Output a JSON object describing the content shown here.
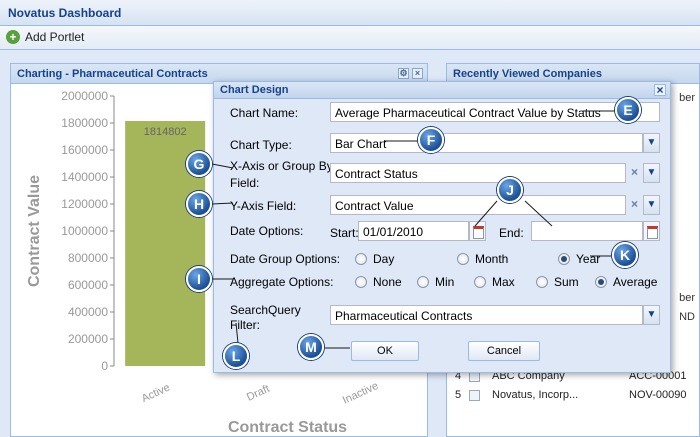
{
  "app": {
    "title": "Novatus Dashboard",
    "add_portlet_label": "Add Portlet"
  },
  "chart_portlet": {
    "title": "Charting - Pharmaceutical Contracts"
  },
  "recent_portlet": {
    "title": "Recently Viewed Companies",
    "col_fragment": "ber",
    "rows": [
      {
        "num": "4",
        "name": "ABC Company",
        "code": "ACC-00001"
      },
      {
        "num": "5",
        "name": "Novatus, Incorp...",
        "code": "NOV-00090"
      }
    ],
    "side_fragments": [
      "ber",
      "ND"
    ]
  },
  "chart_data": {
    "type": "bar",
    "ylabel": "Contract Value",
    "xlabel": "Contract Status",
    "categories": [
      "Active",
      "Draft",
      "Inactive"
    ],
    "values": [
      1814802,
      null,
      null
    ],
    "data_labels": [
      "1814802"
    ],
    "ylim": [
      0,
      2000000
    ],
    "yticks": [
      "0",
      "200000",
      "400000",
      "600000",
      "800000",
      "1000000",
      "1200000",
      "1400000",
      "1600000",
      "1800000",
      "2000000"
    ],
    "bar_color": "#a5b55a"
  },
  "dialog": {
    "title": "Chart Design",
    "chart_name_label": "Chart Name:",
    "chart_name_value": "Average Pharmaceutical Contract Value by Status",
    "chart_type_label": "Chart Type:",
    "chart_type_value": "Bar Chart",
    "xaxis_label_line1": "X-Axis or Group By",
    "xaxis_label_line2": "Field:",
    "xaxis_value": "Contract Status",
    "yaxis_label": "Y-Axis Field:",
    "yaxis_value": "Contract Value",
    "date_options_label": "Date Options:",
    "start_label": "Start:",
    "start_value": "01/01/2010",
    "end_label": "End:",
    "end_value": "",
    "date_group_label": "Date Group Options:",
    "date_group_options": [
      "Day",
      "Month",
      "Year"
    ],
    "date_group_selected": "Year",
    "aggregate_label": "Aggregate Options:",
    "aggregate_options": [
      "None",
      "Min",
      "Max",
      "Sum",
      "Average"
    ],
    "aggregate_selected": "Average",
    "search_filter_label_line1": "SearchQuery",
    "search_filter_label_line2": "Filter:",
    "search_filter_value": "Pharmaceutical Contracts",
    "ok_label": "OK",
    "cancel_label": "Cancel"
  },
  "callouts": {
    "E": "E",
    "F": "F",
    "G": "G",
    "H": "H",
    "I": "I",
    "J": "J",
    "K": "K",
    "L": "L",
    "M": "M"
  },
  "colors": {
    "callout": "#1c4f95",
    "accent": "#15428b"
  }
}
